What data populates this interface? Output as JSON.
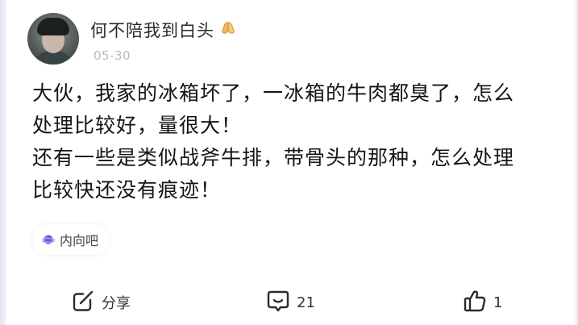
{
  "post": {
    "author": {
      "name": "何不陪我到白头",
      "badge_icon": "praying-hands-icon"
    },
    "date": "05-30",
    "content_lines": [
      "大伙，我家的冰箱坏了，一冰箱的牛肉都臭了，怎么",
      "处理比较好，量很大！",
      "还有一些是类似战斧牛排，带骨头的那种，怎么处理",
      "比较快还没有痕迹！"
    ],
    "topic": {
      "icon": "planet-icon",
      "label": "内向吧"
    }
  },
  "actions": {
    "share": {
      "icon": "share-icon",
      "label": "分享"
    },
    "comment": {
      "icon": "comment-icon",
      "count": "21"
    },
    "like": {
      "icon": "thumbs-up-icon",
      "count": "1"
    }
  },
  "colors": {
    "topic_icon": "#7b4fd6",
    "date_text": "#b9b9c3",
    "edge": "#e6def0"
  }
}
